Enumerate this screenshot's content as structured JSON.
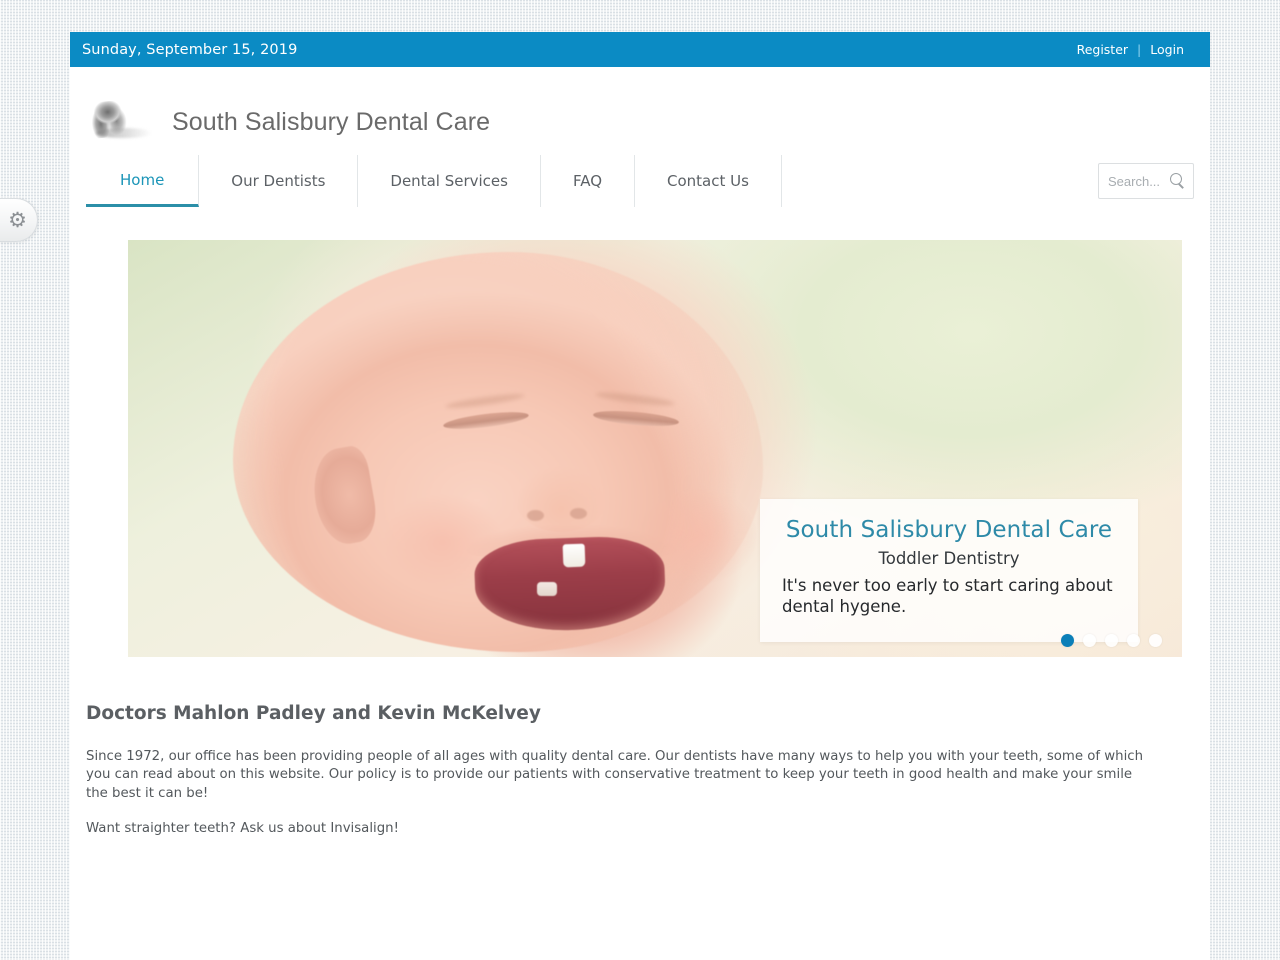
{
  "topbar": {
    "date": "Sunday, September 15, 2019",
    "register_label": "Register",
    "separator": "|",
    "login_label": "Login"
  },
  "brand": {
    "title": "South Salisbury Dental Care",
    "logo_icon": "tooth-logo-icon"
  },
  "nav": {
    "items": [
      {
        "label": "Home",
        "active": true
      },
      {
        "label": "Our Dentists",
        "active": false
      },
      {
        "label": "Dental Services",
        "active": false
      },
      {
        "label": "FAQ",
        "active": false
      },
      {
        "label": "Contact Us",
        "active": false
      }
    ]
  },
  "search": {
    "value": "",
    "placeholder": "Search...",
    "icon": "search-icon"
  },
  "hero": {
    "caption_title": "South Salisbury Dental Care",
    "caption_subtitle": "Toddler Dentistry",
    "caption_text": "It's never too early to start caring about dental hygene.",
    "dots": [
      {
        "active": true
      },
      {
        "active": false
      },
      {
        "active": false
      },
      {
        "active": false
      },
      {
        "active": false
      }
    ]
  },
  "article": {
    "heading": "Doctors Mahlon Padley and Kevin McKelvey",
    "paragraph1": "Since 1972, our office has been providing people of all ages with quality dental care. Our dentists have many ways to help you with your teeth, some of which you can read about on this website. Our policy is to provide our patients with conservative treatment to keep your teeth in good health and make your smile the best it can be!",
    "paragraph2": "Want straighter teeth? Ask us about Invisalign!"
  },
  "side_widget": {
    "icon": "gear-icon",
    "glyph": "⚙"
  },
  "colors": {
    "topbar_blue": "#0b8bc4",
    "accent_teal": "#2e8aa8",
    "nav_active": "#1b95b8",
    "dot_active": "#0b7fb8",
    "body_text": "#53585c",
    "page_background": "#eef1f3"
  }
}
